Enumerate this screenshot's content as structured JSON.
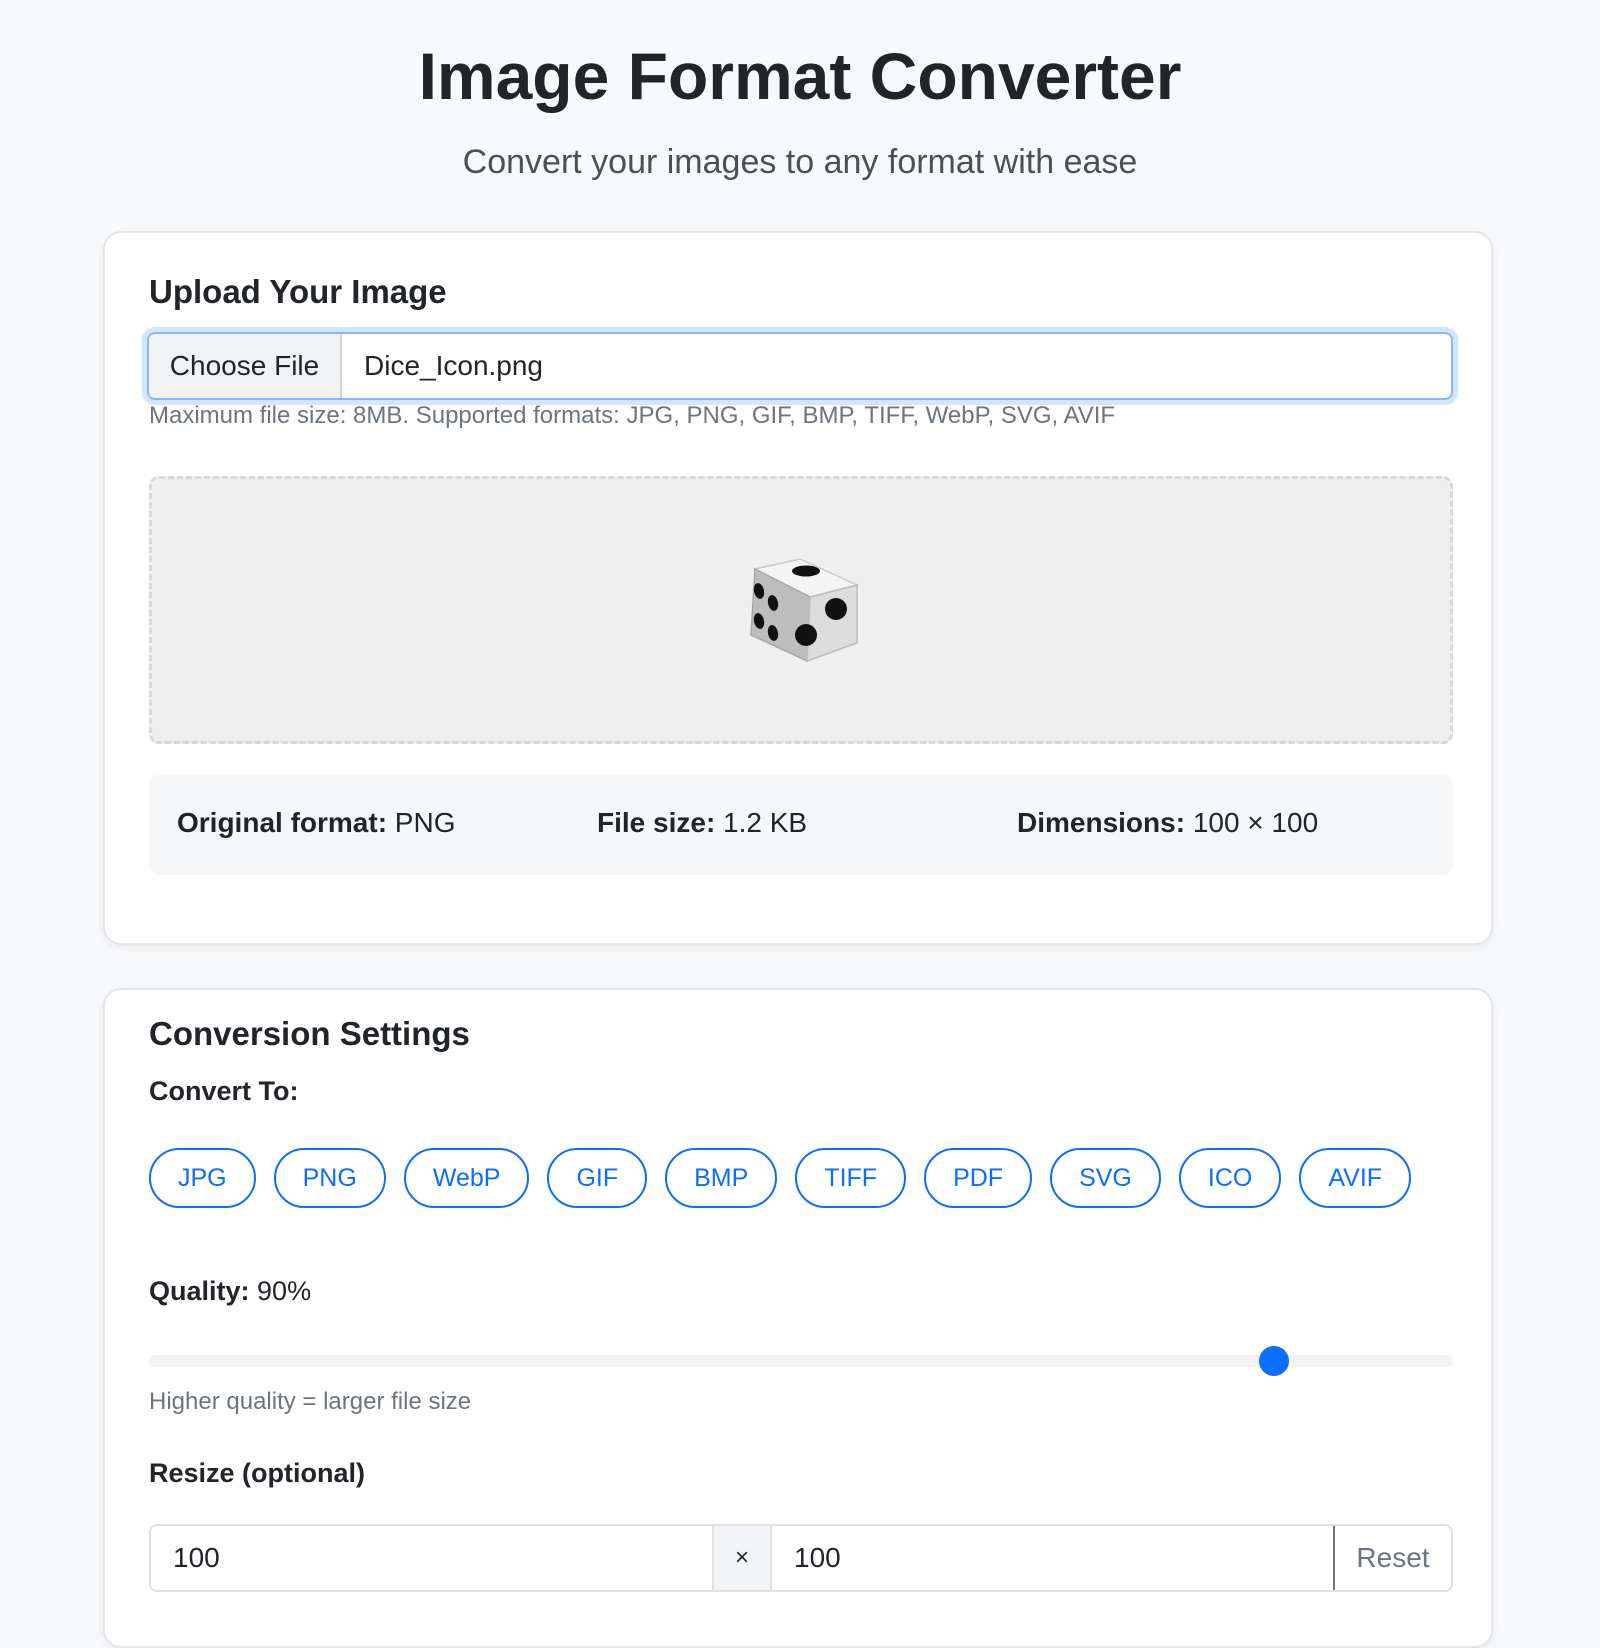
{
  "header": {
    "title": "Image Format Converter",
    "subtitle": "Convert your images to any format with ease"
  },
  "upload": {
    "heading": "Upload Your Image",
    "choose_file_label": "Choose File",
    "file_name": "Dice_Icon.png",
    "help_text": "Maximum file size: 8MB. Supported formats: JPG, PNG, GIF, BMP, TIFF, WebP, SVG, AVIF",
    "preview_icon": "dice-icon",
    "info": {
      "format_label": "Original format:",
      "format_value": "PNG",
      "size_label": "File size:",
      "size_value": "1.2 KB",
      "dimensions_label": "Dimensions:",
      "dimensions_value": "100 × 100"
    }
  },
  "settings": {
    "heading": "Conversion Settings",
    "convert_to_label": "Convert To:",
    "formats": [
      "JPG",
      "PNG",
      "WebP",
      "GIF",
      "BMP",
      "TIFF",
      "PDF",
      "SVG",
      "ICO",
      "AVIF"
    ],
    "quality_label": "Quality:",
    "quality_value": "90%",
    "quality_fraction": 0.9,
    "quality_help": "Higher quality = larger file size",
    "resize_label": "Resize (optional)",
    "resize_width": "100",
    "resize_separator": "×",
    "resize_height": "100",
    "reset_label": "Reset"
  },
  "colors": {
    "accent": "#0d6efd",
    "background": "#f8f9fa",
    "card": "#ffffff"
  }
}
